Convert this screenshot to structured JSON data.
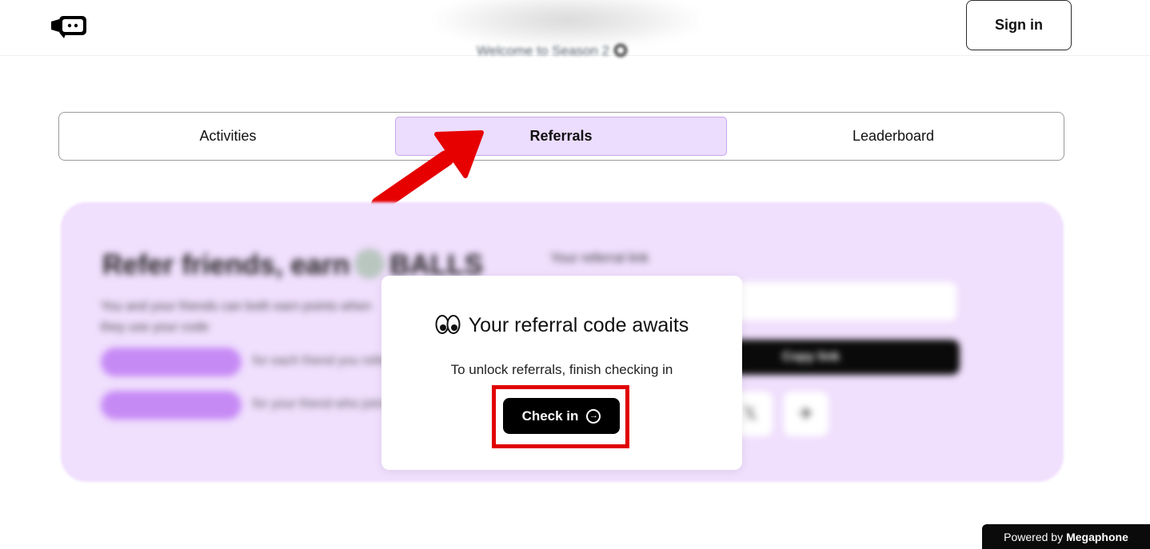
{
  "header": {
    "logo_icon": "megaphone-logo-icon",
    "welcome_text": "Welcome to Season 2",
    "signin_label": "Sign in"
  },
  "tabs": [
    {
      "label": "Activities",
      "active": false
    },
    {
      "label": "Referrals",
      "active": true
    },
    {
      "label": "Leaderboard",
      "active": false
    }
  ],
  "panel": {
    "title": "Refer friends, earn",
    "title_token": "BALLS",
    "description": "You and your friends can both earn points when they use your code",
    "rewards": [
      {
        "pill": "+ points",
        "text": "for each friend you refer"
      },
      {
        "pill": "+ points",
        "text": "for your friend who joins"
      }
    ],
    "code_label": "Your referral link",
    "copy_button": "Copy link"
  },
  "modal": {
    "icon": "eyes-icon",
    "title": "Your referral code awaits",
    "subtitle": "To unlock referrals, finish checking in",
    "button_label": "Check in",
    "button_icon": "arrow-right-circle-icon"
  },
  "footer": {
    "powered_prefix": "Powered by",
    "powered_brand": "Megaphone"
  },
  "colors": {
    "accent_tab": "#ecdcfd",
    "panel_bg": "#f0dffd",
    "annotation_red": "#e00000",
    "button_black": "#000000"
  }
}
